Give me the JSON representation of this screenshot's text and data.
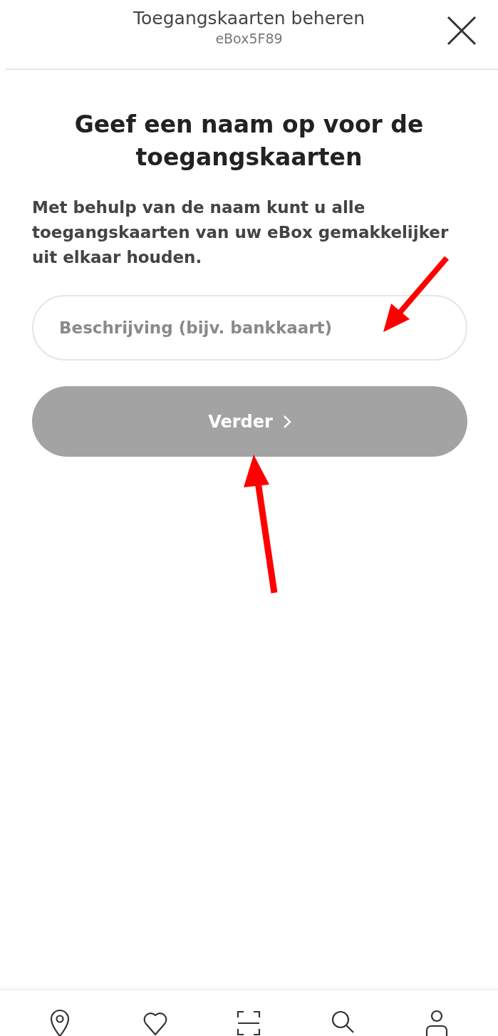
{
  "header": {
    "title": "Toegangskaarten beheren",
    "subtitle": "eBox5F89"
  },
  "heading": "Geef een naam op voor de toegangskaarten",
  "description": "Met behulp van de naam kunt u alle toegangskaarten van uw eBox gemakkelijker uit elkaar houden.",
  "name_field": {
    "placeholder": "Beschrijving (bijv. bankkaart)"
  },
  "continue_button": {
    "label": "Verder",
    "disabled": true
  },
  "bottom_nav": [
    {
      "kind": "pin"
    },
    {
      "kind": "heart"
    },
    {
      "kind": "scan"
    },
    {
      "kind": "search"
    },
    {
      "kind": "user"
    }
  ]
}
